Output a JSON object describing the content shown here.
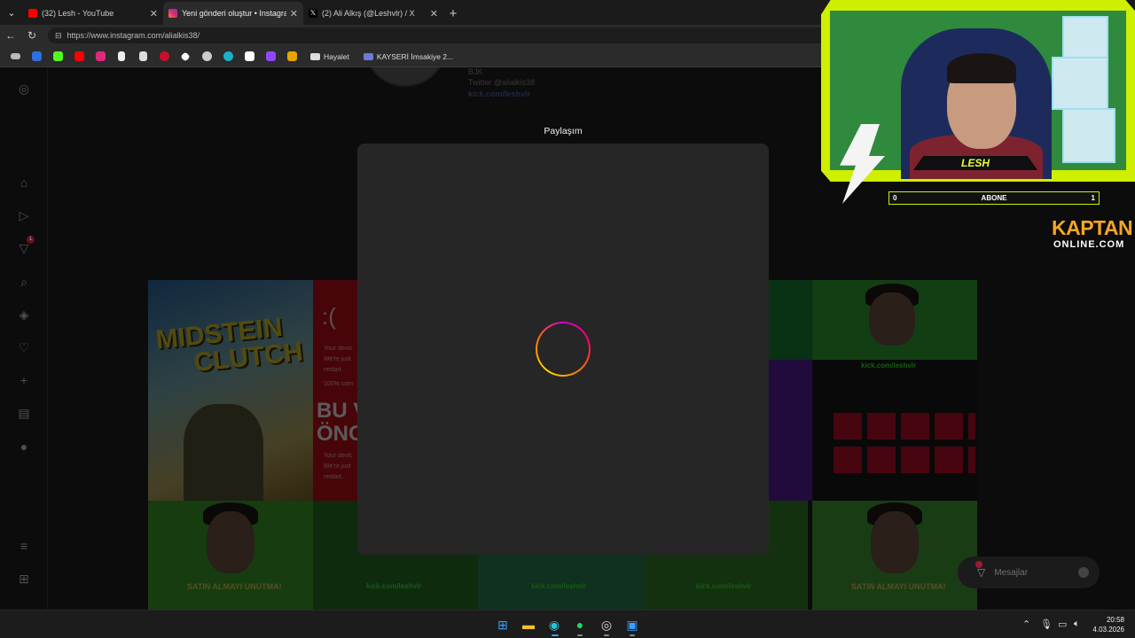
{
  "browser": {
    "tabs": [
      {
        "title": "(32) Lesh - YouTube",
        "favicon_color": "#ff0000",
        "active": false
      },
      {
        "title": "Yeni gönderi oluştur • Instagram",
        "favicon_color": "#e1306c",
        "active": true
      },
      {
        "title": "(2) Ali Alkış (@Leshvlr) / X",
        "favicon_color": "#ffffff",
        "active": false
      }
    ],
    "url": "https://www.instagram.com/alialkis38/",
    "bookmarks_text": [
      "Hayalet",
      "KAYSERİ İmsakiye 2..."
    ]
  },
  "profile": {
    "lines": [
      "BJK",
      "Twitter @alialkis38",
      "kick.com/leshvlr"
    ]
  },
  "grid": {
    "tile1_title_line1": "MIDSTEIN",
    "tile1_title_line2": "CLUTCH",
    "tile2_sad": ":(",
    "tile2_lines": [
      "Your devic",
      "We're just",
      "restart.",
      "100% com"
    ],
    "tile2_big": "BU VİD\nÖNC",
    "tile2_bottom": [
      "Your devic",
      "We're just",
      "restart."
    ],
    "kick_banner": "kick.com/leshvlr",
    "satin_banner": "SATIN ALMAYI UNUTMA!"
  },
  "modal": {
    "title": "Paylaşım"
  },
  "messages": {
    "label": "Mesajlar"
  },
  "stream_overlay": {
    "name": "LESH",
    "sub_left": "0",
    "sub_label": "ABONE",
    "sub_right": "1",
    "sponsor_top": "KAPTAN",
    "sponsor_bottom": "ONLINE.COM"
  },
  "sidebar_badge": "1",
  "taskbar": {
    "time": "20:58",
    "date": "4.03.2026"
  }
}
